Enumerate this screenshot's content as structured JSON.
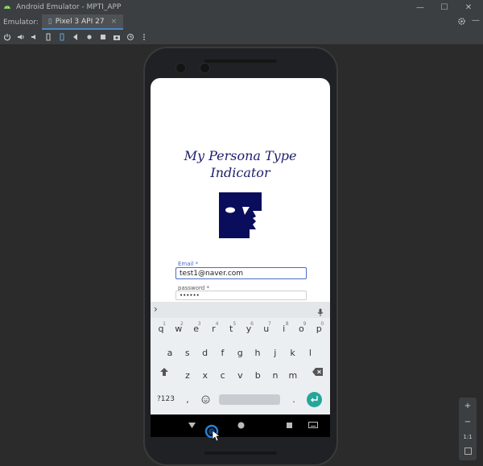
{
  "window": {
    "title": "Android Emulator - MPTI_APP",
    "minimize": "—",
    "maximize": "☐",
    "close": "✕"
  },
  "tabbar": {
    "label": "Emulator:",
    "device_tab": "Pixel 3 API 27",
    "tab_close": "×"
  },
  "toolbar": {
    "icons": [
      "power-icon",
      "volume-up-icon",
      "volume-down-icon",
      "rotate-left-icon",
      "rotate-right-icon",
      "back-icon",
      "home-icon",
      "overview-icon",
      "screenshot-icon",
      "snapshot-icon",
      "more-icon"
    ]
  },
  "zoom": {
    "plus": "+",
    "minus": "−",
    "one_to_one": "1:1"
  },
  "app": {
    "title_line1": "My Persona Type",
    "title_line2": "Indicator",
    "email_label": "Email *",
    "email_value": "test1@naver.com",
    "password_label": "password *",
    "password_value": "••••••"
  },
  "keyboard": {
    "row1": [
      "q",
      "w",
      "e",
      "r",
      "t",
      "y",
      "u",
      "i",
      "o",
      "p"
    ],
    "row1_hints": [
      "1",
      "2",
      "3",
      "4",
      "5",
      "6",
      "7",
      "8",
      "9",
      "0"
    ],
    "row2": [
      "a",
      "s",
      "d",
      "f",
      "g",
      "h",
      "j",
      "k",
      "l"
    ],
    "row3": [
      "z",
      "x",
      "c",
      "v",
      "b",
      "n",
      "m"
    ],
    "sym_key": "?123",
    "comma": ",",
    "period": ".",
    "chevron": "›"
  },
  "colors": {
    "accent": "#4a6cc7",
    "logo_navy": "#0a0d5c",
    "enter_green": "#26a69a"
  }
}
